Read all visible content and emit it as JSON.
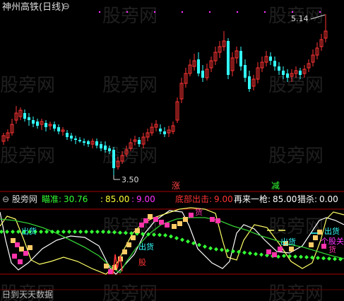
{
  "upper_panel": {
    "title": "神州高铁(日线)",
    "collapse_glyph": "⊖",
    "high_price_label": "5.14",
    "low_price_label": "3.50",
    "up_label": "涨",
    "down_label": "减",
    "candle_up_color": "#ff3333",
    "candle_down_color": "#33ffff"
  },
  "indicator_panel": {
    "collapse_glyph": "⊖",
    "name": "股旁网",
    "params": [
      {
        "label": "瞄准:",
        "value": "30.76",
        "color": "#33ff33"
      },
      {
        "label": ":",
        "value": "85.00",
        "color": "#ffff33"
      },
      {
        "label": ":",
        "value": "9.00",
        "color": "#ff33ff"
      },
      {
        "label": "底部出击:",
        "value": "9.00",
        "color": "#ff3333"
      },
      {
        "label": "再来一枪:",
        "value": "85.00",
        "color": "#ffffff"
      },
      {
        "label": "猎杀:",
        "value": "0.00",
        "color": "#ffffff"
      }
    ],
    "signal_labels": {
      "ship_1": "出货",
      "ship_2": "出货",
      "ship_3": "出货",
      "ship_4": "出货",
      "ship_5": "货",
      "ship_6": "货",
      "watch": "个股关",
      "bottom": "股"
    },
    "footer_text": "日到天天数据"
  },
  "watermark": "股旁网",
  "colors": {
    "background": "#000000",
    "divider": "#aa0000",
    "white_line": "#ffffff",
    "yellow_line": "#ffff66",
    "green_line": "#33cc33",
    "dot_line": "#33ff33",
    "signal_pink": "#ff33aa",
    "signal_orange": "#ffcc66"
  }
}
